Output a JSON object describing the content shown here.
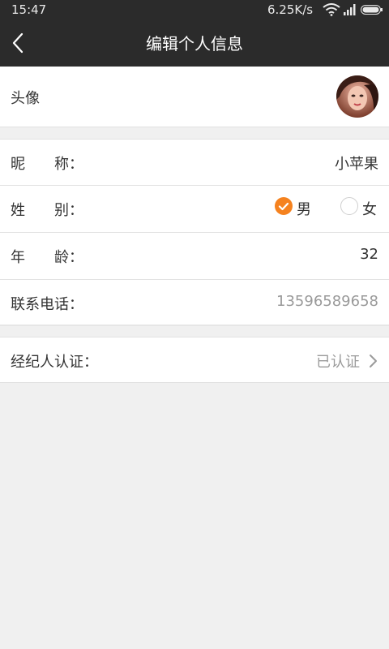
{
  "status_bar": {
    "time": "15:47",
    "network_speed": "6.25K/s",
    "icons": [
      "wifi-icon",
      "signal-icon",
      "battery-icon"
    ]
  },
  "header": {
    "title": "编辑个人信息",
    "back_icon": "back-arrow-icon"
  },
  "profile": {
    "avatar_label": "头像",
    "nickname": {
      "label": "昵　　称：",
      "value": "小苹果"
    },
    "gender": {
      "label": "姓　　别：",
      "options": [
        {
          "label": "男",
          "selected": true
        },
        {
          "label": "女",
          "selected": false
        }
      ]
    },
    "age": {
      "label": "年　　龄：",
      "value": "32"
    },
    "phone": {
      "label": "联系电话：",
      "value": "13596589658"
    },
    "broker": {
      "label": "经纪人认证：",
      "value": "已认证"
    }
  },
  "colors": {
    "header_bg": "#2b2b2b",
    "accent": "#f5821f",
    "page_bg": "#f0f0f0",
    "muted_text": "#9a9a9a"
  }
}
